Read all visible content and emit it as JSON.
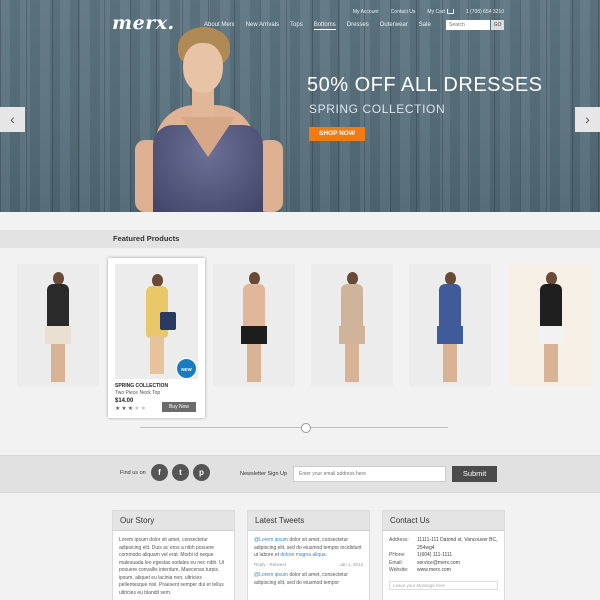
{
  "brand": {
    "logo": "merx."
  },
  "topnav": {
    "account": "My Account",
    "contact": "Contact Us",
    "cart": "My Cart",
    "phone": "1 (708) 654 3210"
  },
  "mainnav": {
    "items": [
      "About Merx",
      "New Arrivals",
      "Tops",
      "Bottoms",
      "Dresses",
      "Outerwear",
      "Sale"
    ],
    "active": "Bottoms"
  },
  "search": {
    "placeholder": "Search",
    "button": "GO"
  },
  "hero": {
    "title": "50% OFF ALL DRESSES",
    "subtitle": "SPRING COLLECTION",
    "cta": "SHOP NOW",
    "prev_icon": "chevron-left-icon",
    "next_icon": "chevron-right-icon"
  },
  "featured": {
    "title": "Featured Products",
    "active_card": {
      "badge": "NEW",
      "category": "SPRING COLLECTION",
      "name": "Two Piece Neck Top",
      "price": "$14.00",
      "rating": 3,
      "max_rating": 5,
      "button": "Buy Now"
    },
    "products": [
      {
        "dress_color": "#2a2a2a",
        "skirt_color": "#e9e0d2"
      },
      {
        "dress_color": "#e9c86a",
        "skirt_color": "#e3c08f"
      },
      {
        "dress_color": "#e2b698",
        "skirt_color": "#1d1d1d"
      },
      {
        "dress_color": "#cfb39b",
        "skirt_color": "#cfb39b"
      },
      {
        "dress_color": "#3f5b9a",
        "skirt_color": "#3f5b9a"
      },
      {
        "dress_color": "#1f1f1f",
        "skirt_color": "#f2f2f2"
      }
    ],
    "slider_position": 0.54
  },
  "social": {
    "label": "Find us on",
    "icons": [
      "facebook-icon",
      "twitter-icon",
      "pinterest-icon"
    ],
    "glyphs": [
      "f",
      "t",
      "p"
    ]
  },
  "newsletter": {
    "label": "Newsletter Sign Up",
    "placeholder": "Enter your email address here",
    "button": "Submit"
  },
  "our_story": {
    "title": "Our Story",
    "text": "Lorem ipsum dolor sit amet, consectetur adipiscing elit. Duis ac eros a nibh posuere commodo aliquam vel erat. Morbi id neque malesuada leo egestas sodales eu nec nibh. Ut posuere convallis interdum. Maecenas turpis ipsum, aliquet eu lacinia non, ultricies pellentesque nisl. Praesent semper dui et tellus ultricies eu blandit sem."
  },
  "tweets": {
    "title": "Latest Tweets",
    "items": [
      {
        "handle": "@Lorem ipsum",
        "text": " dolor sit amet, consectetur adipiscing elit, sed do eiusmod tempor incididunt ut labore et ",
        "link": "dolore magna aliqua.",
        "actions": "Reply - Retweet",
        "date": "Jan 1, 2013"
      },
      {
        "handle": "@Lorem ipsum",
        "text": " dolor sit amet, consectetur adipiscing elit, sed do eiusmod tempor",
        "link": "",
        "actions": "",
        "date": ""
      }
    ]
  },
  "contact": {
    "title": "Contact Us",
    "rows": [
      {
        "k": "Address:",
        "v": "11111-111 Datond st, Vancouver BC, 254wg4"
      },
      {
        "k": "PHone:",
        "v": "1(604) 111-1111"
      },
      {
        "k": "Email:",
        "v": "service@merx.com"
      },
      {
        "k": "Website:",
        "v": "www.merx.com"
      }
    ],
    "message_placeholder": "Leave your Message here"
  }
}
